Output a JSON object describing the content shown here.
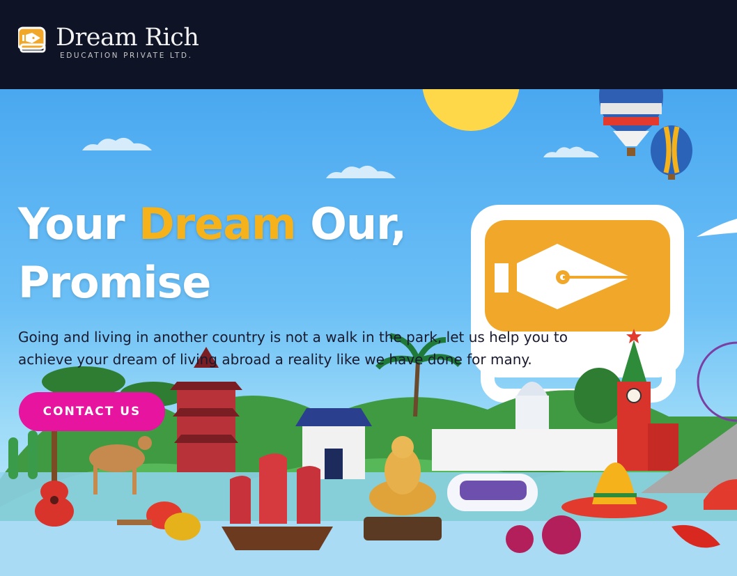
{
  "header": {
    "brand_name": "Dream Rich",
    "brand_subtitle": "EDUCATION PRIVATE LTD.",
    "logo_icon": "pen-nib-icon"
  },
  "hero": {
    "headline_part1": "Your ",
    "headline_accent": "Dream",
    "headline_part2": " Our,",
    "headline_line2": "Promise",
    "description": "Going and living in another country is not a walk in the park, let us help you to achieve your dream of living abroad a reality like we have done for many.",
    "cta_label": "CONTACT US"
  },
  "colors": {
    "header_bg": "#0e1426",
    "accent_yellow": "#f5b21b",
    "cta_pink": "#e6149f",
    "sky_blue": "#4aa8f0"
  }
}
